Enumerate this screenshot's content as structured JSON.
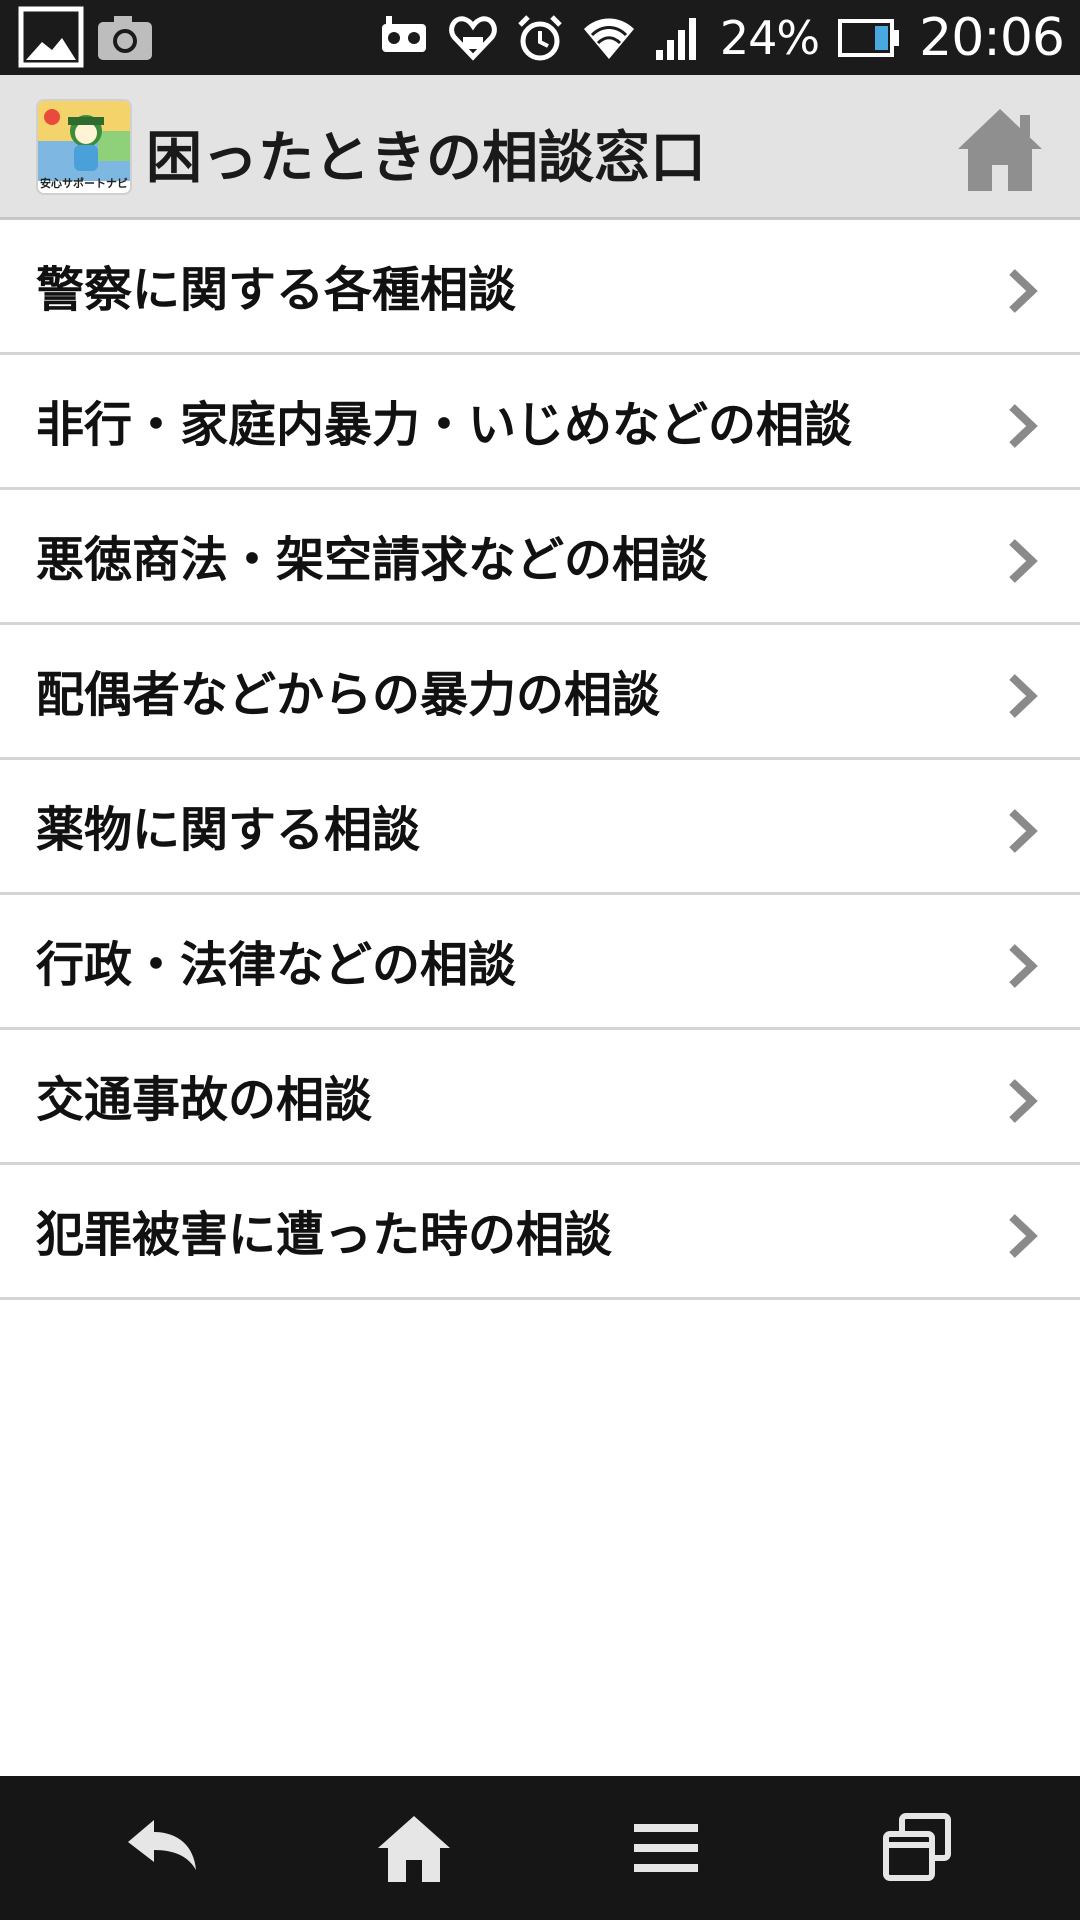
{
  "status_bar": {
    "battery_percent": "24%",
    "time": "20:06"
  },
  "header": {
    "logo_caption": "安心サポートナビ",
    "title": "困ったときの相談窓口"
  },
  "menu": {
    "items": [
      {
        "label": "警察に関する各種相談"
      },
      {
        "label": "非行・家庭内暴力・いじめなどの相談"
      },
      {
        "label": "悪徳商法・架空請求などの相談"
      },
      {
        "label": "配偶者などからの暴力の相談"
      },
      {
        "label": "薬物に関する相談"
      },
      {
        "label": "行政・法律などの相談"
      },
      {
        "label": "交通事故の相談"
      },
      {
        "label": "犯罪被害に遭った時の相談"
      }
    ]
  },
  "icons": {
    "status_left": [
      "gallery-icon",
      "camera-icon"
    ],
    "status_right": [
      "vr-headset-icon",
      "heart-notification-icon",
      "alarm-icon",
      "wifi-icon",
      "signal-icon",
      "battery-icon"
    ],
    "header": "home-icon",
    "list_item": "chevron-right-icon",
    "nav": [
      "back-icon",
      "home-icon",
      "menu-icon",
      "recent-apps-icon"
    ]
  },
  "colors": {
    "header_background": "#e3e3e3",
    "status_bar_background": "#1b1b1b",
    "nav_bar_background": "#161616",
    "divider": "#d4d4d4",
    "chevron": "#8a8a8a",
    "battery_level": "#4aa8e0"
  }
}
